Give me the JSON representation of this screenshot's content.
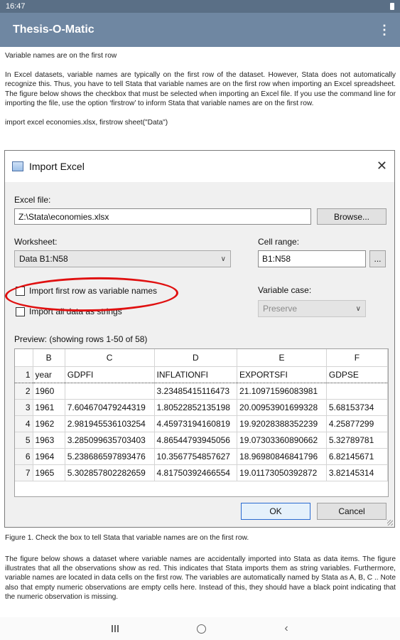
{
  "status_bar": {
    "time": "16:47"
  },
  "app_bar": {
    "title": "Thesis-O-Matic",
    "menu_icon": "more-vert-icon"
  },
  "article": {
    "heading": "Variable names are on the first row",
    "intro": "In Excel datasets, variable names are typically on the first row of the dataset. However, Stata does not automatically recognize this. Thus, you have to tell Stata that variable names are on the first row when importing an Excel spreadsheet. The figure below shows the checkbox that must be selected when importing an Excel file. If you use the command line for importing the file, use the option ‘firstrow’ to inform Stata that variable names are on the first row.",
    "command": "import excel economies.xlsx, firstrow sheet(\"Data\")",
    "caption": "Figure 1. Check the box to tell Stata that variable names are on the first row.",
    "body": "The figure below shows a dataset where variable names are accidentally imported into Stata as data items. The figure illustrates that all the observations show as red. This indicates that Stata imports them as string variables. Furthermore, variable names are located in data cells on the first row. The variables are automatically named by Stata as A, B, C .. Note also that empty numeric observations are empty cells here. Instead of this, they should have a black point indicating that the numeric observation is missing."
  },
  "dialog": {
    "title": "Import Excel",
    "excel_file_label": "Excel file:",
    "excel_file_value": "Z:\\Stata\\economies.xlsx",
    "browse_label": "Browse...",
    "worksheet_label": "Worksheet:",
    "worksheet_value": "Data B1:N58",
    "cell_range_label": "Cell range:",
    "cell_range_value": "B1:N58",
    "cell_range_button": "...",
    "import_first_row_label": "Import first row as variable names",
    "import_first_row_checked": false,
    "import_strings_label": "Import all data as strings",
    "import_strings_checked": false,
    "variable_case_label": "Variable case:",
    "variable_case_value": "Preserve",
    "preview_label": "Preview: (showing rows 1-50 of 58)",
    "ok_label": "OK",
    "cancel_label": "Cancel",
    "preview": {
      "columns": [
        "",
        "B",
        "C",
        "D",
        "E",
        "F"
      ],
      "rows": [
        [
          "1",
          "year",
          "GDPFI",
          "INFLATIONFI",
          "EXPORTSFI",
          "GDPSE"
        ],
        [
          "2",
          "1960",
          "",
          "3.23485415116473",
          "21.10971596083981",
          ""
        ],
        [
          "3",
          "1961",
          "7.604670479244319",
          "1.80522852135198",
          "20.00953901699328",
          "5.68153734"
        ],
        [
          "4",
          "1962",
          "2.981945536103254",
          "4.45973194160819",
          "19.92028388352239",
          "4.25877299"
        ],
        [
          "5",
          "1963",
          "3.285099635703403",
          "4.86544793945056",
          "19.07303360890662",
          "5.32789781"
        ],
        [
          "6",
          "1964",
          "5.238686597893476",
          "10.3567754857627",
          "18.96980846841796",
          "6.82145671"
        ],
        [
          "7",
          "1965",
          "5.302857802282659",
          "4.81750392466554",
          "19.01173050392872",
          "3.82145314"
        ]
      ]
    }
  }
}
